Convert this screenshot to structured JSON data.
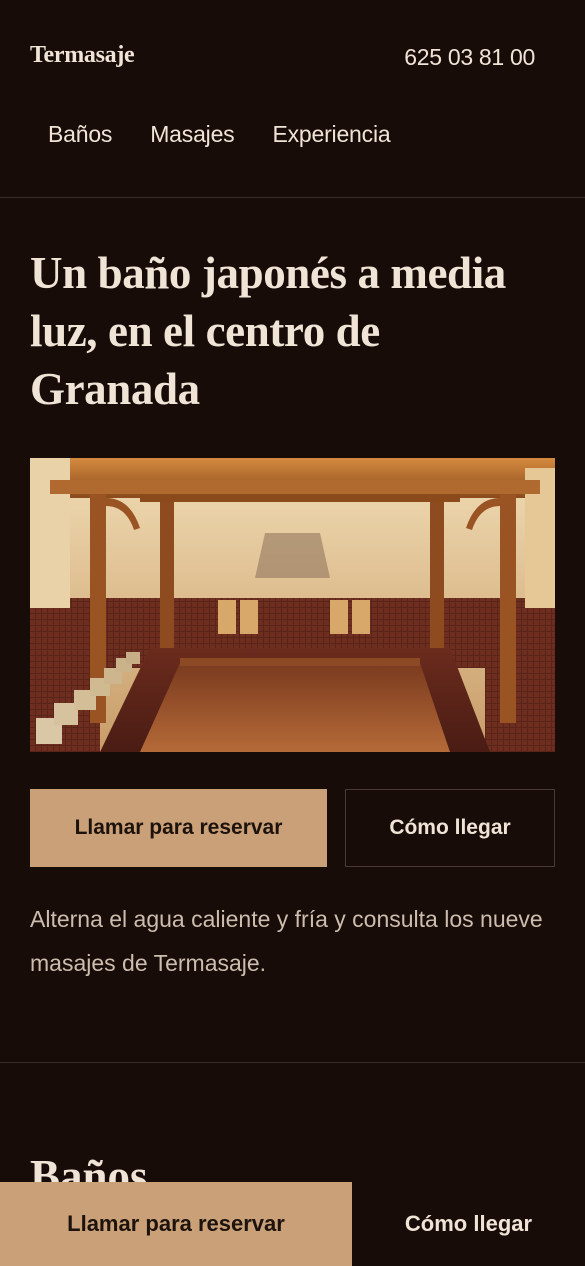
{
  "header": {
    "brand": "Termasaje",
    "phone": "625 03 81 00",
    "nav": [
      "Baños",
      "Masajes",
      "Experiencia"
    ]
  },
  "hero": {
    "title": "Un baño japonés a media luz, en el centro de Granada",
    "primary_cta": "Llamar para reservar",
    "secondary_cta": "Cómo llegar",
    "description": "Alterna el agua caliente y fría y consulta los nueve masajes de Termasaje."
  },
  "next_section": {
    "title": "Baños"
  },
  "sticky_bar": {
    "call_label": "Llamar para reservar",
    "directions_label": "Cómo llegar"
  },
  "colors": {
    "background": "#170c08",
    "accent": "#c9a077",
    "text": "#efe4d6"
  }
}
